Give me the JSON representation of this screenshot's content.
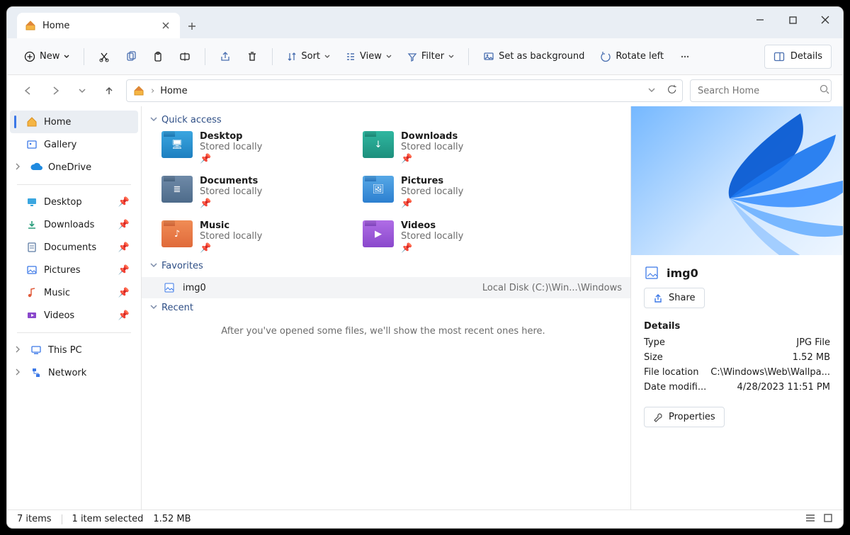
{
  "tab": {
    "title": "Home"
  },
  "toolbar": {
    "new": "New",
    "sort": "Sort",
    "view": "View",
    "filter": "Filter",
    "set_bg": "Set as background",
    "rotate_left": "Rotate left",
    "details": "Details"
  },
  "address": {
    "path": "Home"
  },
  "search": {
    "placeholder": "Search Home"
  },
  "sidebar": {
    "home": "Home",
    "gallery": "Gallery",
    "onedrive": "OneDrive",
    "pinned": [
      {
        "label": "Desktop"
      },
      {
        "label": "Downloads"
      },
      {
        "label": "Documents"
      },
      {
        "label": "Pictures"
      },
      {
        "label": "Music"
      },
      {
        "label": "Videos"
      }
    ],
    "thispc": "This PC",
    "network": "Network"
  },
  "sections": {
    "quick_access": "Quick access",
    "favorites": "Favorites",
    "recent": "Recent"
  },
  "quick_access": [
    {
      "name": "Desktop",
      "sub": "Stored locally",
      "ic": "blue",
      "glyph": "🖥"
    },
    {
      "name": "Downloads",
      "sub": "Stored locally",
      "ic": "teal",
      "glyph": "↓"
    },
    {
      "name": "Documents",
      "sub": "Stored locally",
      "ic": "steel",
      "glyph": "≣"
    },
    {
      "name": "Pictures",
      "sub": "Stored locally",
      "ic": "sky",
      "glyph": "🖼"
    },
    {
      "name": "Music",
      "sub": "Stored locally",
      "ic": "orange",
      "glyph": "♪"
    },
    {
      "name": "Videos",
      "sub": "Stored locally",
      "ic": "purple",
      "glyph": "▶"
    }
  ],
  "favorites": [
    {
      "name": "img0",
      "location": "Local Disk (C:)\\Win...\\Windows"
    }
  ],
  "recent_empty": "After you've opened some files, we'll show the most recent ones here.",
  "details_pane": {
    "filename": "img0",
    "share": "Share",
    "header": "Details",
    "rows": [
      {
        "k": "Type",
        "v": "JPG File"
      },
      {
        "k": "Size",
        "v": "1.52 MB"
      },
      {
        "k": "File location",
        "v": "C:\\Windows\\Web\\Wallpa..."
      },
      {
        "k": "Date modifi...",
        "v": "4/28/2023 11:51 PM"
      }
    ],
    "properties": "Properties"
  },
  "status": {
    "count": "7 items",
    "selected": "1 item selected",
    "size": "1.52 MB"
  }
}
